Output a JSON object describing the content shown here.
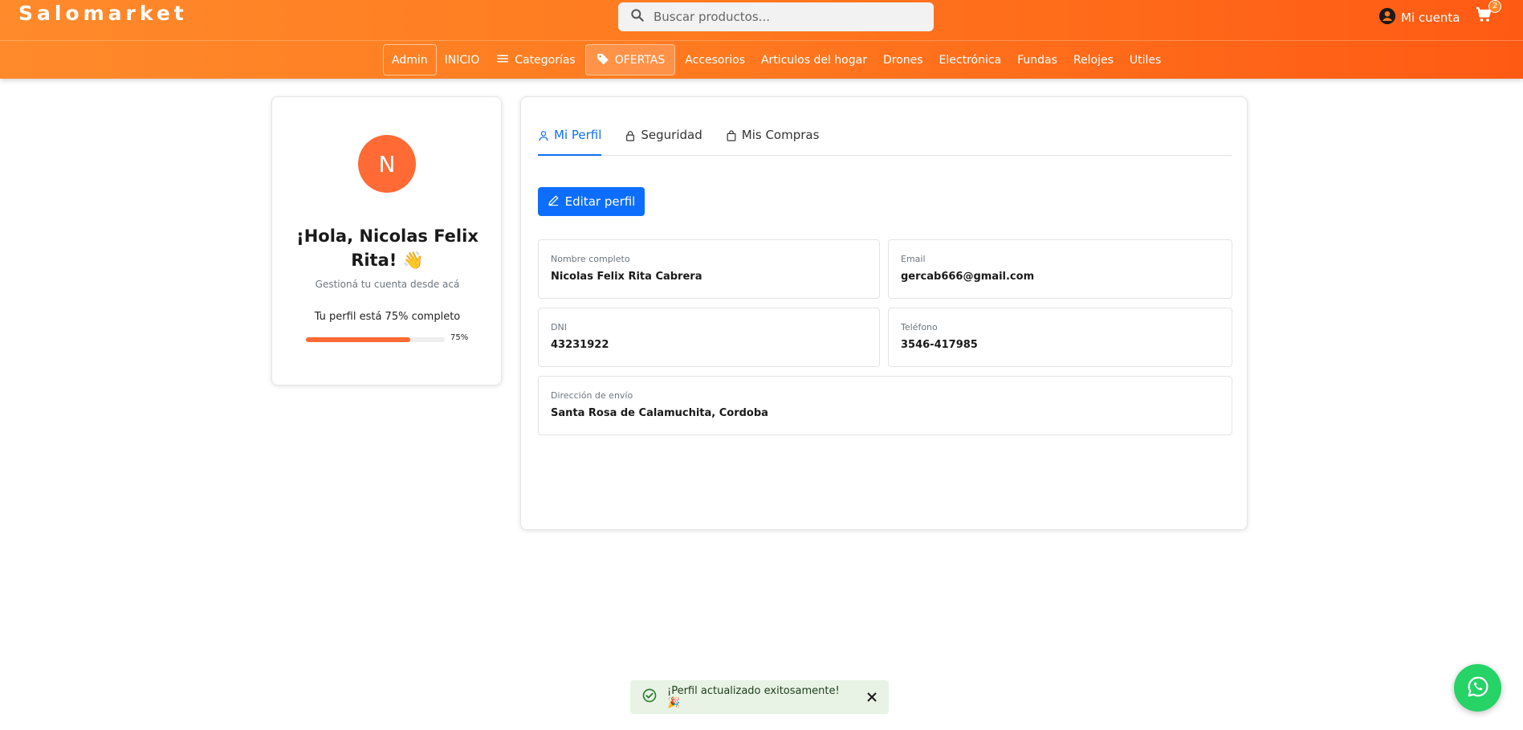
{
  "header": {
    "brand": "Salomarket",
    "search_placeholder": "Buscar productos...",
    "account_label": "Mi cuenta",
    "cart_count": "2"
  },
  "nav": {
    "items": [
      {
        "label": "Admin"
      },
      {
        "label": "INICIO"
      },
      {
        "label": "Categorías"
      },
      {
        "label": "OFERTAS"
      },
      {
        "label": "Accesorios"
      },
      {
        "label": "Articulos del hogar"
      },
      {
        "label": "Drones"
      },
      {
        "label": "Electrónica"
      },
      {
        "label": "Fundas"
      },
      {
        "label": "Relojes"
      },
      {
        "label": "Utiles"
      }
    ]
  },
  "profile": {
    "avatar_initial": "N",
    "greeting": "¡Hola, Nicolas Felix Rita! 👋",
    "subtitle": "Gestioná tu cuenta desde acá",
    "progress_text": "Tu perfil está 75% completo",
    "progress_value": 75,
    "progress_label": "75%"
  },
  "tabs": [
    {
      "label": "Mi Perfil",
      "active": true
    },
    {
      "label": "Seguridad",
      "active": false
    },
    {
      "label": "Mis Compras",
      "active": false
    }
  ],
  "edit_button": "Editar perfil",
  "fields": {
    "name": {
      "label": "Nombre completo",
      "value": "Nicolas Felix Rita Cabrera"
    },
    "email": {
      "label": "Email",
      "value": "gercab666@gmail.com"
    },
    "dni": {
      "label": "DNI",
      "value": "43231922"
    },
    "phone": {
      "label": "Teléfono",
      "value": "3546-417985"
    },
    "address": {
      "label": "Dirección de envío",
      "value": "Santa Rosa de Calamuchita, Cordoba"
    }
  },
  "toast": {
    "message": "¡Perfil actualizado exitosamente! 🎉"
  },
  "colors": {
    "brand_orange": "#ff7a1f",
    "accent_blue": "#0d6efd",
    "avatar_orange": "#ff6a35",
    "whatsapp_green": "#25d366"
  }
}
